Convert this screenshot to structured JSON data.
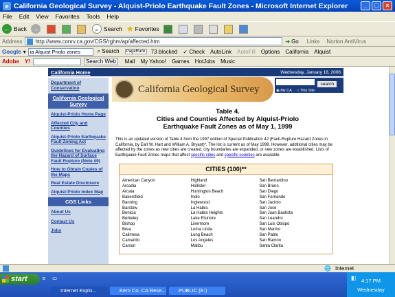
{
  "window": {
    "title": "California Geological Survey - Alquist-Priolo Earthquake Fault Zones - Microsoft Internet Explorer"
  },
  "menu": [
    "File",
    "Edit",
    "View",
    "Favorites",
    "Tools",
    "Help"
  ],
  "toolbar": {
    "back": "Back",
    "search": "Search",
    "favorites": "Favorites"
  },
  "address": {
    "label": "Address",
    "url": "http://www.conrv.ca.gov/CGS/rghm/ap/affected.htm",
    "go": "Go",
    "links": "Links",
    "norton": "Norton AntiVirus"
  },
  "google_bar": {
    "label": "Google",
    "query": "ia Alquist Priolo zones",
    "search": "Search",
    "pagerank": "PageRank",
    "blocked": "73 blocked",
    "check": "Check",
    "autolink": "AutoLink",
    "autofill": "AutoFill",
    "options": "Options",
    "california": "California",
    "alquist": "Alquist"
  },
  "yahoo_bar": {
    "adobe": "Adobe",
    "yahoo": "Y!",
    "search_web": "Search Web",
    "mail": "Mail",
    "my_yahoo": "My Yahoo!",
    "games": "Games",
    "hotjobs": "HotJobs",
    "music": "Music"
  },
  "page": {
    "topnav_home": "California Home",
    "date": "Wednesday, January 18, 2006",
    "dept_link": "Department of Conservation",
    "cgs_header": "California Geological Survey",
    "left_links": [
      "Alquist-Priolo Home Page",
      "Affected City and Counties",
      "Alquist-Priolo Earthquake Fault Zoning Act",
      "Guidelines for Evaluating the Hazard of Surface Fault Rupture (Note 49)",
      "How to Obtain Copies of the Maps",
      "Real Estate Disclosure",
      "Alquist-Priolo Index Map"
    ],
    "cgs_links_header": "CGS Links",
    "cgs_links": [
      "About Us",
      "Contact Us",
      "Jobs"
    ],
    "logo_text": "California Geological Survey",
    "search_button": "search",
    "radio_myca": "My CA",
    "radio_thissite": "This Site",
    "table_title_1": "Table 4.",
    "table_title_2": "Cities and Counties Affected by Alquist-Priolo",
    "table_title_3": "Earthquake Fault Zones as of May 1, 1999",
    "intro_1": "This is an updated version of Table 4 from the 1997 edition of Special Publication 42 (Fault-Rupture Hazard Zones in California, by Earl W. Hart and William A. Bryant)*. The list is current as of May 1999. However, additional cities may be affected by the zones as new cities are created, city boundaries are expanded, or new zones are established. Lists of Earthquake Fault Zones maps that affect",
    "intro_link1": "specific cities",
    "intro_and": "and",
    "intro_link2": "specific counties",
    "intro_end": "are available.",
    "cities_header": "CITIES (100)**",
    "cities_col1": [
      "American Canyon",
      "Arcadia",
      "Arcata",
      "Bakersfield",
      "Banning",
      "Barstow",
      "Benicia",
      "Berkeley",
      "Bishop",
      "Brea",
      "Calimesa",
      "Camarillo",
      "Carson"
    ],
    "cities_col2": [
      "Highland",
      "Hollister",
      "Huntington Beach",
      "Indio",
      "Inglewood",
      "La Habra",
      "La Habra Heights",
      "Lake Elsinore",
      "Livermore",
      "Loma Linda",
      "Long Beach",
      "Los Angeles",
      "Malibu"
    ],
    "cities_col3": [
      "San Bernardino",
      "San Bruno",
      "San Diego",
      "San Fernando",
      "San Jacinto",
      "San Jose",
      "San Juan Bautista",
      "San Leandro",
      "San Luis Obispo",
      "San Marino",
      "San Pablo",
      "San Ramon",
      "Santa Clarita"
    ]
  },
  "status": {
    "zone": "Internet"
  },
  "taskbar": {
    "start": "start",
    "tasks": [
      "Internet Explo...",
      "Kern Co. CA Rese...",
      "PUBLIC (E:)"
    ],
    "time": "4:17 PM",
    "day": "Wednesday"
  }
}
